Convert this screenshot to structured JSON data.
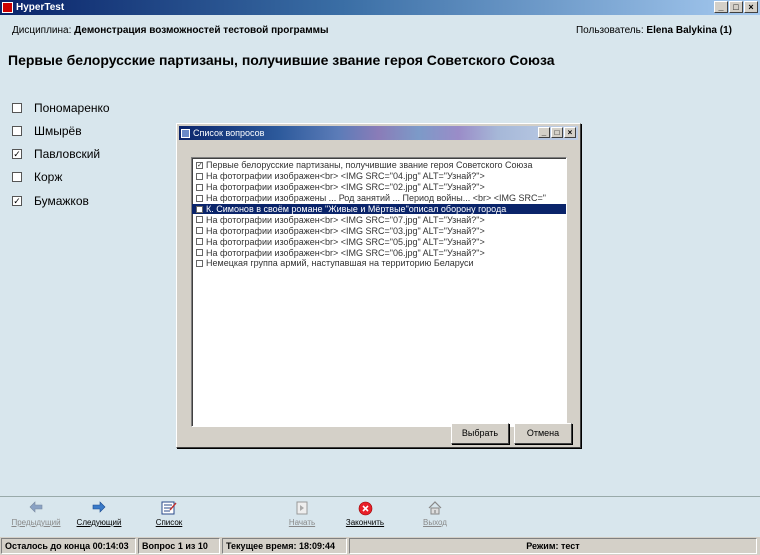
{
  "window": {
    "title": "HyperTest",
    "min": "_",
    "max": "□",
    "close": "×"
  },
  "info": {
    "discipline_label": "Дисциплина:",
    "discipline_value": "Демонстрация возможностей тестовой программы",
    "user_label": "Пользователь:",
    "user_value": "Elena Balykina (1)"
  },
  "question": {
    "title": "Первые белорусские партизаны, получившие звание героя Советского Союза",
    "answers": [
      {
        "label": "Пономаренко",
        "checked": false
      },
      {
        "label": "Шмырёв",
        "checked": false
      },
      {
        "label": "Павловский",
        "checked": true
      },
      {
        "label": "Корж",
        "checked": false
      },
      {
        "label": "Бумажков",
        "checked": true
      }
    ]
  },
  "dialog": {
    "title": "Список вопросов",
    "items": [
      {
        "text": "Первые белорусские партизаны, получившие звание героя Советского Союза",
        "checked": true,
        "selected": false
      },
      {
        "text": "На фотографии изображен<br> <IMG SRC=\"04.jpg\" ALT=\"Узнай?\">",
        "checked": false,
        "selected": false
      },
      {
        "text": "На фотографии изображен<br> <IMG SRC=\"02.jpg\" ALT=\"Узнай?\">",
        "checked": false,
        "selected": false
      },
      {
        "text": "На фотографии изображены ... Род занятий ... Период войны... <br> <IMG SRC=\"",
        "checked": false,
        "selected": false
      },
      {
        "text": "К. Симонов в своём романе \"Живые и Мёртвые\"описал оборону города",
        "checked": false,
        "selected": true
      },
      {
        "text": "На фотографии изображен<br> <IMG SRC=\"07.jpg\" ALT=\"Узнай?\">",
        "checked": false,
        "selected": false
      },
      {
        "text": "На фотографии изображен<br> <IMG SRC=\"03.jpg\" ALT=\"Узнай?\">",
        "checked": false,
        "selected": false
      },
      {
        "text": "На фотографии изображен<br> <IMG SRC=\"05.jpg\" ALT=\"Узнай?\">",
        "checked": false,
        "selected": false
      },
      {
        "text": "На фотографии изображен<br> <IMG SRC=\"06.jpg\" ALT=\"Узнай?\">",
        "checked": false,
        "selected": false
      },
      {
        "text": "Немецкая группа армий, наступавшая на территорию Беларуси",
        "checked": false,
        "selected": false
      }
    ],
    "choose_label": "Выбрать",
    "cancel_label": "Отмена"
  },
  "toolbar": {
    "prev": {
      "label": "Предыдущий",
      "icon": "arrow-left-icon",
      "enabled": false
    },
    "next": {
      "label": "Следующий",
      "icon": "arrow-right-icon",
      "enabled": true
    },
    "list": {
      "label": "Список",
      "icon": "list-icon",
      "enabled": true
    },
    "start": {
      "label": "Начать",
      "icon": "start-icon",
      "enabled": false
    },
    "finish": {
      "label": "Закончить",
      "icon": "stop-icon",
      "enabled": true
    },
    "exit": {
      "label": "Выход",
      "icon": "home-icon",
      "enabled": false
    }
  },
  "status": {
    "remaining": "Осталось до конца 00:14:03",
    "question": "Вопрос 1 из 10",
    "time": "Текущее время: 18:09:44",
    "mode": "Режим: тест"
  },
  "colors": {
    "background": "#d8e6ed",
    "selection": "#0a246a",
    "stop": "#e8202a"
  }
}
